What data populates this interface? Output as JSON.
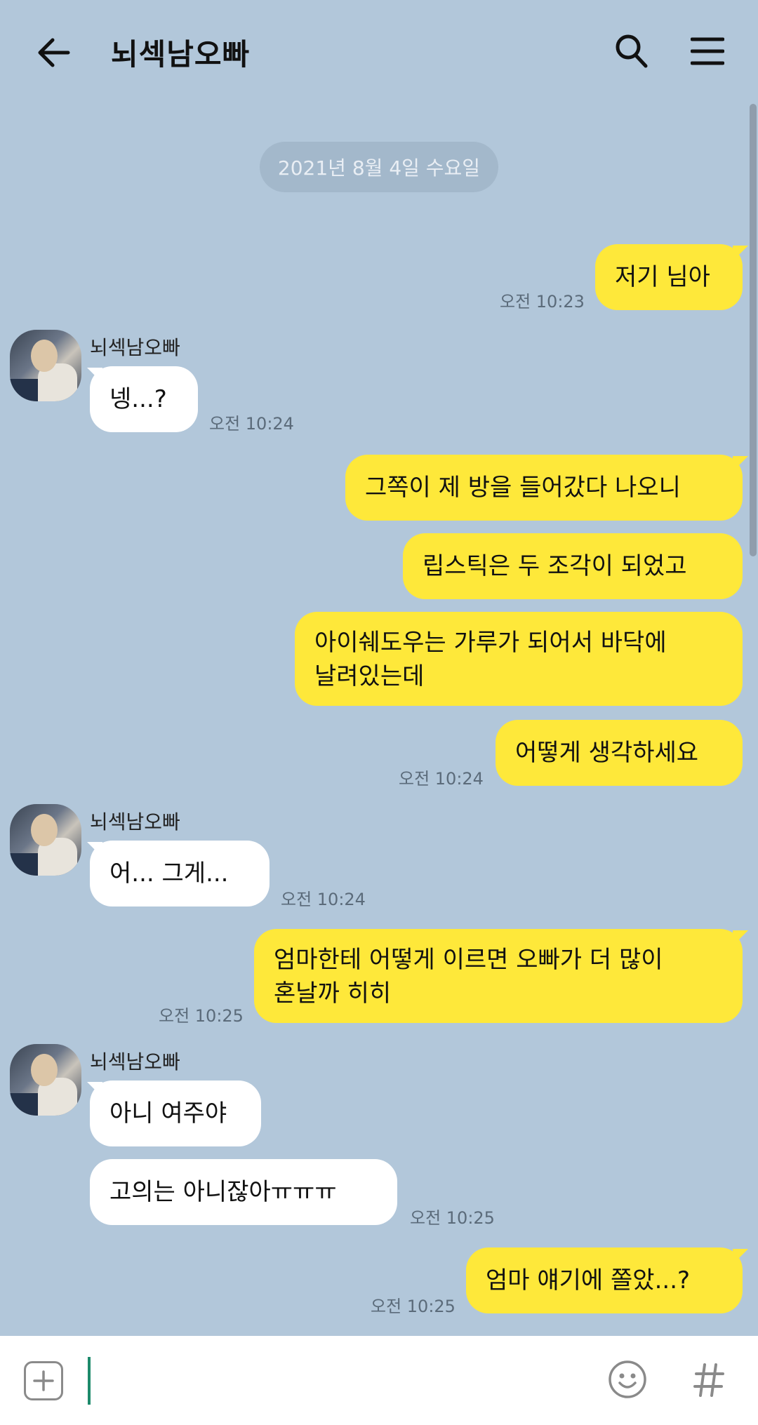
{
  "header": {
    "title": "뇌섹남오빠"
  },
  "date_divider": "2021년 8월 4일 수요일",
  "messages": [
    {
      "from": "me",
      "text": "저기 님아",
      "time": "오전 10:23"
    },
    {
      "from": "other",
      "sender": "뇌섹남오빠",
      "text": "넹...?",
      "time": "오전 10:24"
    },
    {
      "from": "me",
      "text": "그쪽이 제 방을 들어갔다 나오니"
    },
    {
      "from": "me",
      "text": "립스틱은 두 조각이 되었고"
    },
    {
      "from": "me",
      "line1": "아이쉐도우는 가루가 되어서 바닥에",
      "line2": "날려있는데"
    },
    {
      "from": "me",
      "text": "어떻게 생각하세요",
      "time": "오전 10:24"
    },
    {
      "from": "other",
      "sender": "뇌섹남오빠",
      "text": "어... 그게...",
      "time": "오전 10:24"
    },
    {
      "from": "me",
      "line1": "엄마한테 어떻게 이르면 오빠가 더 많이",
      "line2": "혼날까 히히",
      "time": "오전 10:25"
    },
    {
      "from": "other",
      "sender": "뇌섹남오빠",
      "text": "아니 여주야"
    },
    {
      "from": "other",
      "text": "고의는 아니잖아ㅠㅠㅠ",
      "time": "오전 10:25"
    },
    {
      "from": "me",
      "text": "엄마 얘기에 쫄았...?",
      "time": "오전 10:25"
    }
  ],
  "input_bar": {
    "placeholder": ""
  },
  "colors": {
    "background": "#b2c7da",
    "my_bubble": "#fee83a",
    "other_bubble": "#ffffff"
  }
}
